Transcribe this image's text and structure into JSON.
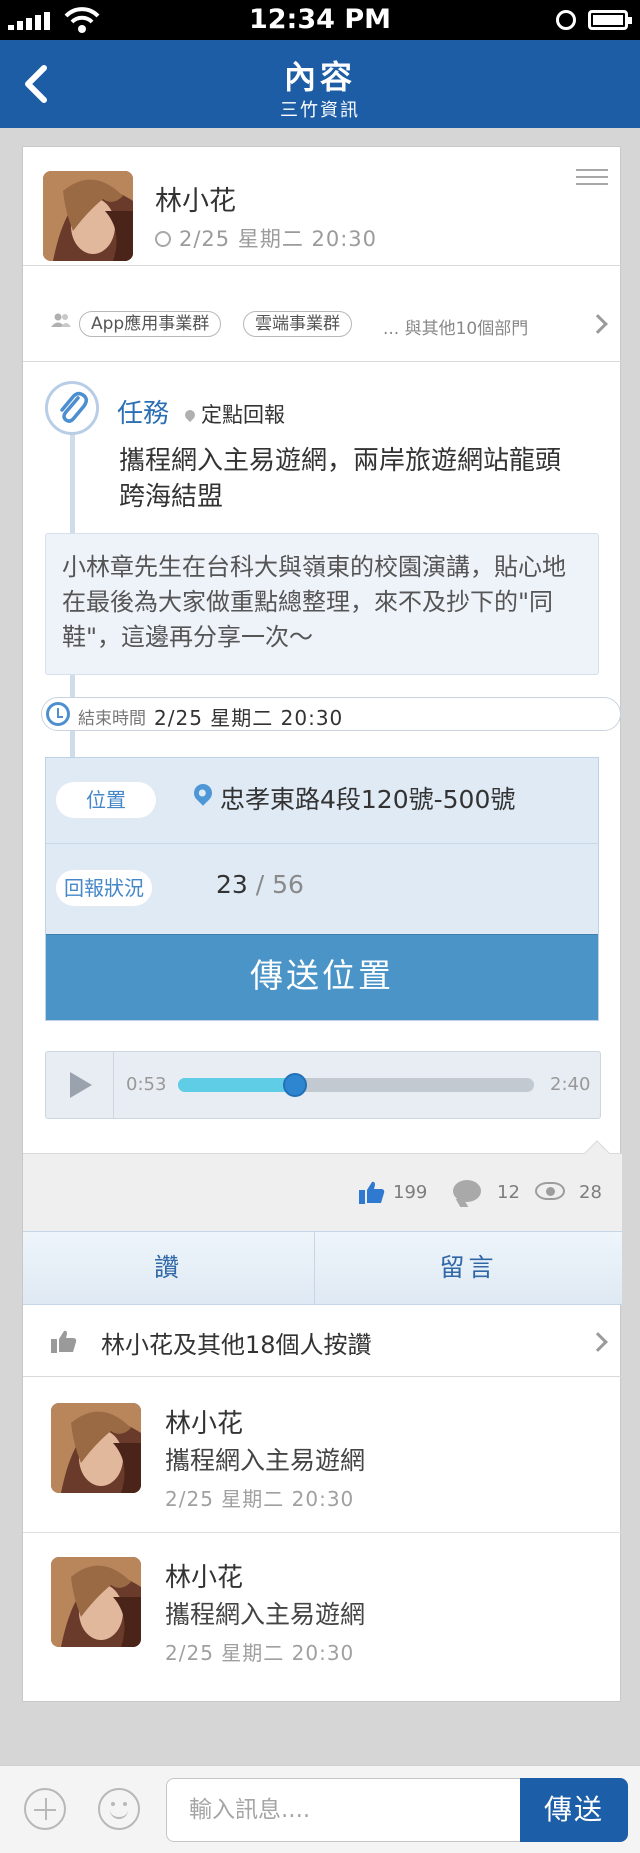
{
  "status_bar": {
    "time": "12:34 PM"
  },
  "nav": {
    "title": "內容",
    "subtitle": "三竹資訊"
  },
  "post": {
    "author": "林小花",
    "time": "2/25 星期二 20:30",
    "audience": {
      "tags": [
        "App應用事業群",
        "雲端事業群"
      ],
      "more": "... 與其他10個部門"
    },
    "task": {
      "label": "任務",
      "location_tag": "定點回報",
      "headline": "攜程網入主易遊網，兩岸旅遊網站龍頭跨海結盟",
      "description": "小林章先生在台科大與嶺東的校園演講，貼心地在最後為大家做重點總整理，來不及抄下的\"同鞋\"，這邊再分享一次～",
      "end_label": "結束時間",
      "end_time": "2/25  星期二  20:30",
      "location_label": "位置",
      "location": "忠孝東路4段120號-500號",
      "report_label": "回報狀況",
      "report_done": "23",
      "report_sep": "/",
      "report_total": "56",
      "send_location": "傳送位置"
    },
    "audio": {
      "current": "0:53",
      "total": "2:40",
      "progress": 0.33
    },
    "stats": {
      "likes": "199",
      "comments": "12",
      "views": "28"
    },
    "actions": {
      "like": "讚",
      "comment": "留言"
    },
    "likes_summary": "林小花及其他18個人按讚"
  },
  "comments": [
    {
      "name": "林小花",
      "text": "攜程網入主易遊網",
      "time": "2/25 星期二 20:30"
    },
    {
      "name": "林小花",
      "text": "攜程網入主易遊網",
      "time": "2/25 星期二 20:30"
    }
  ],
  "composer": {
    "placeholder": "輸入訊息....",
    "send": "傳送"
  },
  "colors": {
    "nav": "#1c5da6",
    "accent": "#4b94c8",
    "progress": "#5fcde6"
  }
}
